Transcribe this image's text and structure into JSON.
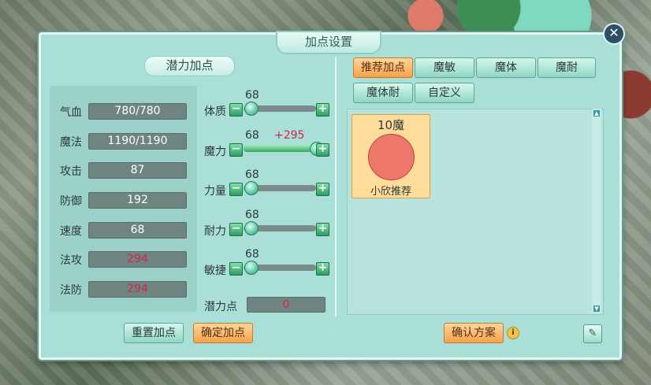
{
  "window": {
    "title": "加点设置",
    "close_symbol": "✕"
  },
  "left": {
    "section_title": "潜力加点",
    "stats": [
      {
        "label": "气血",
        "value": "780/780"
      },
      {
        "label": "魔法",
        "value": "1190/1190"
      },
      {
        "label": "攻击",
        "value": "87"
      },
      {
        "label": "防御",
        "value": "192"
      },
      {
        "label": "速度",
        "value": "68"
      },
      {
        "label": "法攻",
        "value": "294"
      },
      {
        "label": "法防",
        "value": "294"
      }
    ],
    "attributes": [
      {
        "label": "体质",
        "value": "68",
        "bonus": "",
        "level": 0.1
      },
      {
        "label": "魔力",
        "value": "68",
        "bonus": "+295",
        "level": 1.0
      },
      {
        "label": "力量",
        "value": "68",
        "bonus": "",
        "level": 0.1
      },
      {
        "label": "耐力",
        "value": "68",
        "bonus": "",
        "level": 0.1
      },
      {
        "label": "敏捷",
        "value": "68",
        "bonus": "",
        "level": 0.1
      }
    ],
    "potential": {
      "label": "潜力点",
      "value": "0"
    },
    "reset_button": "重置加点",
    "confirm_button": "确定加点"
  },
  "right": {
    "scheme_tabs": [
      "推荐加点",
      "魔敏",
      "魔体",
      "魔耐",
      "魔体耐",
      "自定义"
    ],
    "active_tab": 0,
    "card": {
      "title": "10魔",
      "label": "小欣推荐",
      "color": "#ee776b"
    },
    "confirm_scheme_button": "确认方案",
    "info_icon": "i",
    "edit_icon": "✎"
  }
}
